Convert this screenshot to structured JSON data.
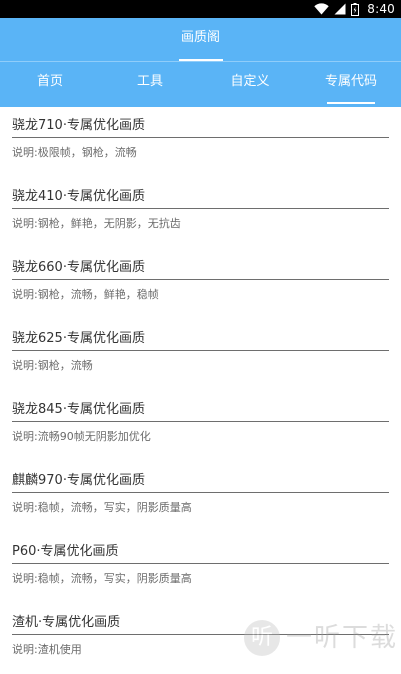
{
  "status_bar": {
    "time": "8:40",
    "icons": [
      "wifi-icon",
      "signal-icon",
      "battery-icon"
    ]
  },
  "header": {
    "title": "画质阁"
  },
  "tabs": [
    {
      "label": "首页",
      "active": false
    },
    {
      "label": "工具",
      "active": false
    },
    {
      "label": "自定义",
      "active": false
    },
    {
      "label": "专属代码",
      "active": true
    }
  ],
  "items": [
    {
      "title": "骁龙710·专属优化画质",
      "desc": "说明:极限帧，钢枪，流畅"
    },
    {
      "title": "骁龙410·专属优化画质",
      "desc": "说明:钢枪，鲜艳，无阴影，无抗齿"
    },
    {
      "title": "骁龙660·专属优化画质",
      "desc": "说明:钢枪，流畅，鲜艳，稳帧"
    },
    {
      "title": "骁龙625·专属优化画质",
      "desc": "说明:钢枪，流畅"
    },
    {
      "title": "骁龙845·专属优化画质",
      "desc": "说明:流畅90帧无阴影加优化"
    },
    {
      "title": "麒麟970·专属优化画质",
      "desc": "说明:稳帧，流畅，写实，阴影质量高"
    },
    {
      "title": "P60·专属优化画质",
      "desc": "说明:稳帧，流畅，写实，阴影质量高"
    },
    {
      "title": "渣机·专属优化画质",
      "desc": "说明:渣机使用"
    }
  ],
  "watermark": {
    "glyph": "听",
    "text": "一听下载"
  },
  "colors": {
    "header_bg": "#5ab4f6",
    "status_bg": "#000000",
    "text_primary": "#333333",
    "text_secondary": "#6b6b6b"
  }
}
